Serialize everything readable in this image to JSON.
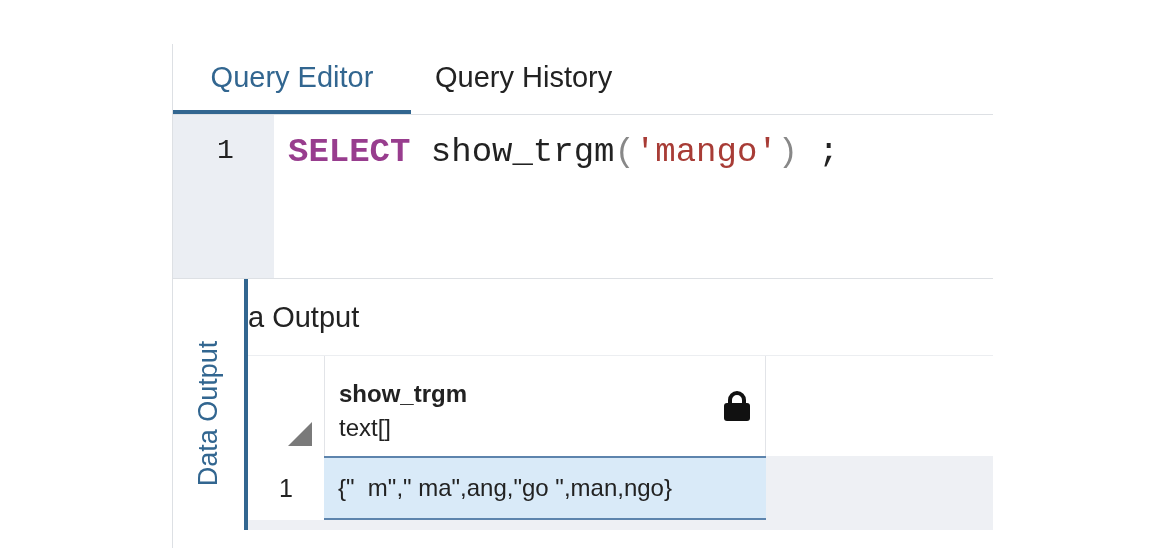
{
  "tabs": [
    {
      "label": "Query Editor",
      "selected": true
    },
    {
      "label": "Query History",
      "selected": false
    }
  ],
  "editor": {
    "lines": [
      {
        "number": "1",
        "tokens": [
          {
            "text": "SELECT",
            "kind": "keyword"
          },
          {
            "text": " show_trgm",
            "kind": "plain"
          },
          {
            "text": "(",
            "kind": "punct"
          },
          {
            "text": "'mango'",
            "kind": "string"
          },
          {
            "text": ")",
            "kind": "punct"
          },
          {
            "text": " ;",
            "kind": "plain"
          }
        ]
      }
    ]
  },
  "output_panel": {
    "side_tab": {
      "label": "Data Output",
      "selected": true
    },
    "heading": "a Output",
    "grid": {
      "columns": [
        {
          "name": "show_trgm",
          "type": "text[]",
          "locked": true
        }
      ],
      "rows": [
        {
          "number": "1",
          "cells": [
            {
              "text": "{\"  m\",\" ma\",ang,\"go \",man,ngo}",
              "selected": true
            }
          ]
        }
      ]
    }
  }
}
